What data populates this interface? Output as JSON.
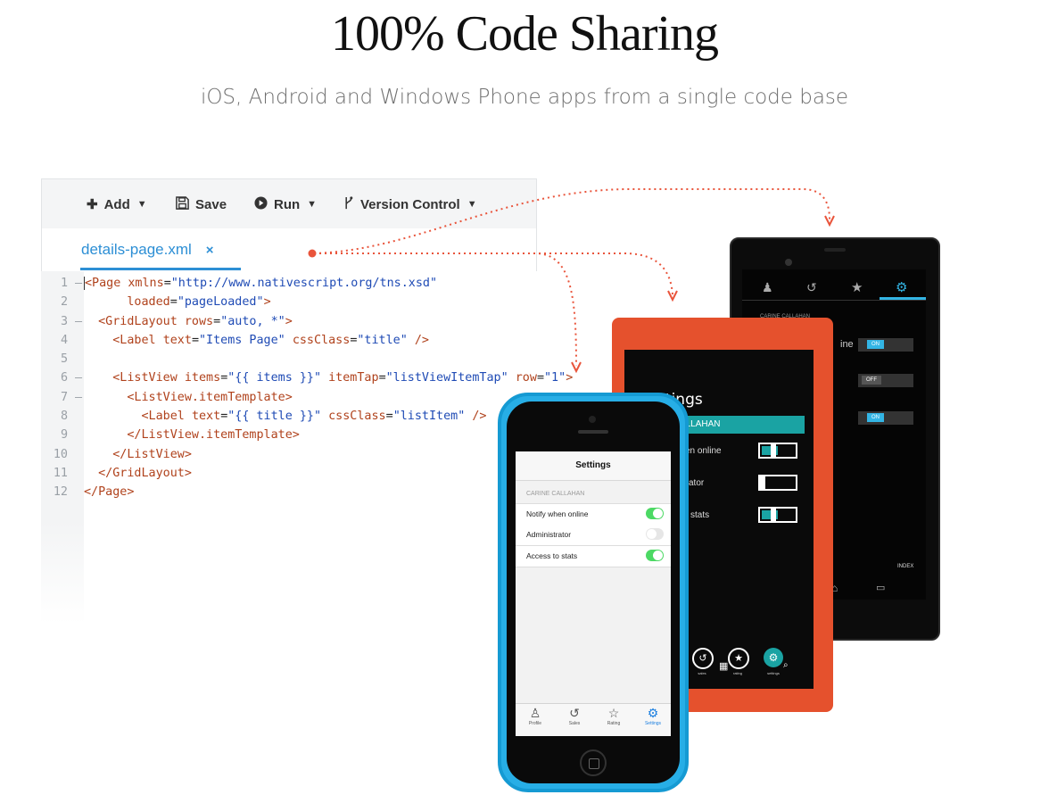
{
  "header": {
    "title": "100% Code Sharing",
    "subtitle": "iOS, Android and Windows Phone apps from a single code base"
  },
  "toolbar": {
    "add_label": "Add",
    "save_label": "Save",
    "run_label": "Run",
    "version_control_label": "Version Control"
  },
  "editor": {
    "tab_label": "details-page.xml",
    "close_glyph": "×",
    "line_numbers": [
      "1",
      "2",
      "3",
      "4",
      "5",
      "6",
      "7",
      "8",
      "9",
      "10",
      "11",
      "12"
    ]
  },
  "ios_app": {
    "nav_title": "Settings",
    "section_header": "CARINE CALLAHAN",
    "rows": [
      "Notify when online",
      "Administrator",
      "Access to stats"
    ],
    "tabs": [
      "Profile",
      "Sales",
      "Rating",
      "Settings"
    ]
  },
  "windows_app": {
    "page_title": "Settings",
    "header_text": "RINE CALLAHAN",
    "rows": [
      "en online",
      "ator",
      "stats"
    ],
    "tabs": [
      "sales",
      "rating",
      "settings"
    ]
  },
  "android_app": {
    "header_text": "CARINE CALLAHAN",
    "row1_fragment": "ine",
    "toggles": [
      "ON",
      "OFF",
      "ON"
    ],
    "footer_label": "INDEX"
  },
  "colors": {
    "accent_blue": "#2d8fd5",
    "arrow_red": "#e9543b",
    "iphone_blue": "#27aee6",
    "lumia_orange": "#e5512d",
    "toggle_green": "#4cd964"
  }
}
